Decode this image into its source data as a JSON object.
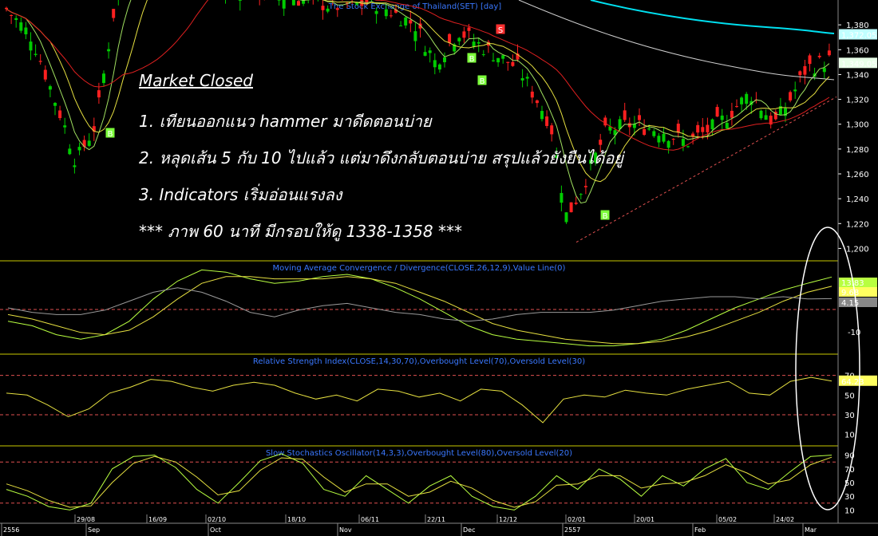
{
  "chart_title": "The Stock Exchange of Thailand(SET) [day]",
  "annotations": {
    "heading": "Market Closed",
    "line1": "1. เทียนออกแนว hammer มาดีดตอนบ่าย",
    "line2": "2. หลุดเส้น 5 กับ 10 ไปแล้ว แต่มาดึงกลับตอนบ่าย สรุปแล้วยังยืนได้อยู่",
    "line3": "3. Indicators เริ่มอ่อนแรงลง",
    "line4": "*** ภาพ 60 นาที มีกรอบให้ดู 1338-1358 ***"
  },
  "colors": {
    "background": "#000000",
    "up_candle": "#00cc00",
    "down_candle": "#ff2020",
    "ma_fast": "#a0e060",
    "ma_mid": "#e6e040",
    "ma_slow": "#e02020",
    "ma_long": "#d0d0d0",
    "ma_longest": "#00e0f0",
    "panel_title": "#3a78ff",
    "separator": "#c8c800",
    "dashed_level": "#e05050"
  },
  "chart_data": [
    {
      "type": "candlestick",
      "panel": "price",
      "title": "The Stock Exchange of Thailand(SET) [day]",
      "ylim": [
        1190,
        1400
      ],
      "yticks": [
        1200,
        1220,
        1240,
        1260,
        1280,
        1300,
        1320,
        1340,
        1360,
        1380
      ],
      "last_close_label": "1,349.05",
      "long_ma_label": "1,372.05",
      "x_labels": [
        "29/08",
        "16/09",
        "02/10",
        "18/10",
        "06/11",
        "22/11",
        "12/12",
        "02/01",
        "20/01",
        "05/02",
        "24/02"
      ],
      "month_labels": [
        "2556",
        "Sep",
        "Oct",
        "Nov",
        "Dec",
        "2557",
        "Feb",
        "Mar"
      ],
      "signals": [
        {
          "label": "B",
          "type": "buy"
        },
        {
          "label": "B",
          "type": "buy"
        },
        {
          "label": "B",
          "type": "buy"
        },
        {
          "label": "S",
          "type": "sell"
        },
        {
          "label": "B",
          "type": "buy"
        }
      ],
      "support_line": {
        "from": 1205,
        "to": 1322,
        "style": "dashed"
      }
    },
    {
      "type": "line",
      "panel": "macd",
      "title": "Moving Average Convergence / Divergence(CLOSE,26,12,9),Value Line(0)",
      "ylim": [
        -20,
        20
      ],
      "ytick_labels": [
        "-10"
      ],
      "value_labels": [
        "13.83",
        "9.68",
        "4.15"
      ],
      "series": [
        {
          "values": [
            -6,
            -8,
            -12,
            -14,
            -12,
            -6,
            4,
            12,
            17,
            16,
            13,
            11,
            12,
            14,
            15,
            13,
            9,
            4,
            -2,
            -8,
            -12,
            -14,
            -15,
            -16,
            -17,
            -17,
            -16,
            -14,
            -10,
            -5,
            0,
            4,
            8,
            11,
            13.83
          ]
        },
        {
          "values": [
            -3,
            -5,
            -8,
            -11,
            -12,
            -10,
            -4,
            4,
            11,
            14,
            14,
            13,
            13,
            13,
            14,
            13,
            11,
            7,
            3,
            -2,
            -7,
            -10,
            -12,
            -14,
            -15,
            -16,
            -16,
            -15,
            -13,
            -10,
            -6,
            -2,
            3,
            7,
            9.68
          ]
        },
        {
          "values": [
            0,
            -2,
            -3,
            -3,
            -1,
            3,
            7,
            9,
            7,
            3,
            -2,
            -4,
            -1,
            1,
            2,
            0,
            -2,
            -3,
            -5,
            -6,
            -5,
            -3,
            -2,
            -2,
            -2,
            -1,
            1,
            3,
            4,
            5,
            5,
            4,
            5,
            4,
            4.15
          ]
        }
      ]
    },
    {
      "type": "line",
      "panel": "rsi",
      "title": "Relative Strength Index(CLOSE,14,30,70),Overbought Level(70),Oversold Level(30)",
      "ylim": [
        0,
        90
      ],
      "yticks": [
        10,
        30,
        50,
        70
      ],
      "levels": [
        70,
        30
      ],
      "value_label": "64.23",
      "series": [
        {
          "values": [
            52,
            50,
            40,
            28,
            36,
            52,
            58,
            66,
            64,
            58,
            54,
            60,
            63,
            60,
            52,
            46,
            50,
            44,
            56,
            54,
            48,
            52,
            44,
            56,
            54,
            40,
            22,
            46,
            50,
            48,
            55,
            52,
            50,
            56,
            60,
            64,
            52,
            50,
            64,
            68,
            64.23
          ]
        }
      ]
    },
    {
      "type": "line",
      "panel": "stochastics",
      "title": "Slow Stochastics Oscillator(14,3,3),Overbought Level(80),Oversold Level(20)",
      "ylim": [
        0,
        100
      ],
      "yticks": [
        10,
        30,
        50,
        70,
        90
      ],
      "levels": [
        80,
        20
      ],
      "series": [
        {
          "values": [
            40,
            30,
            15,
            10,
            20,
            70,
            88,
            90,
            72,
            40,
            20,
            50,
            82,
            92,
            78,
            40,
            30,
            60,
            40,
            20,
            45,
            60,
            30,
            15,
            10,
            30,
            60,
            40,
            70,
            55,
            30,
            60,
            45,
            70,
            85,
            50,
            40,
            65,
            88,
            90
          ]
        },
        {
          "values": [
            48,
            38,
            24,
            14,
            16,
            50,
            78,
            88,
            80,
            58,
            32,
            38,
            68,
            86,
            84,
            58,
            36,
            48,
            48,
            30,
            36,
            52,
            42,
            24,
            14,
            22,
            46,
            48,
            60,
            60,
            42,
            48,
            50,
            60,
            76,
            64,
            48,
            54,
            76,
            87
          ]
        }
      ]
    }
  ]
}
